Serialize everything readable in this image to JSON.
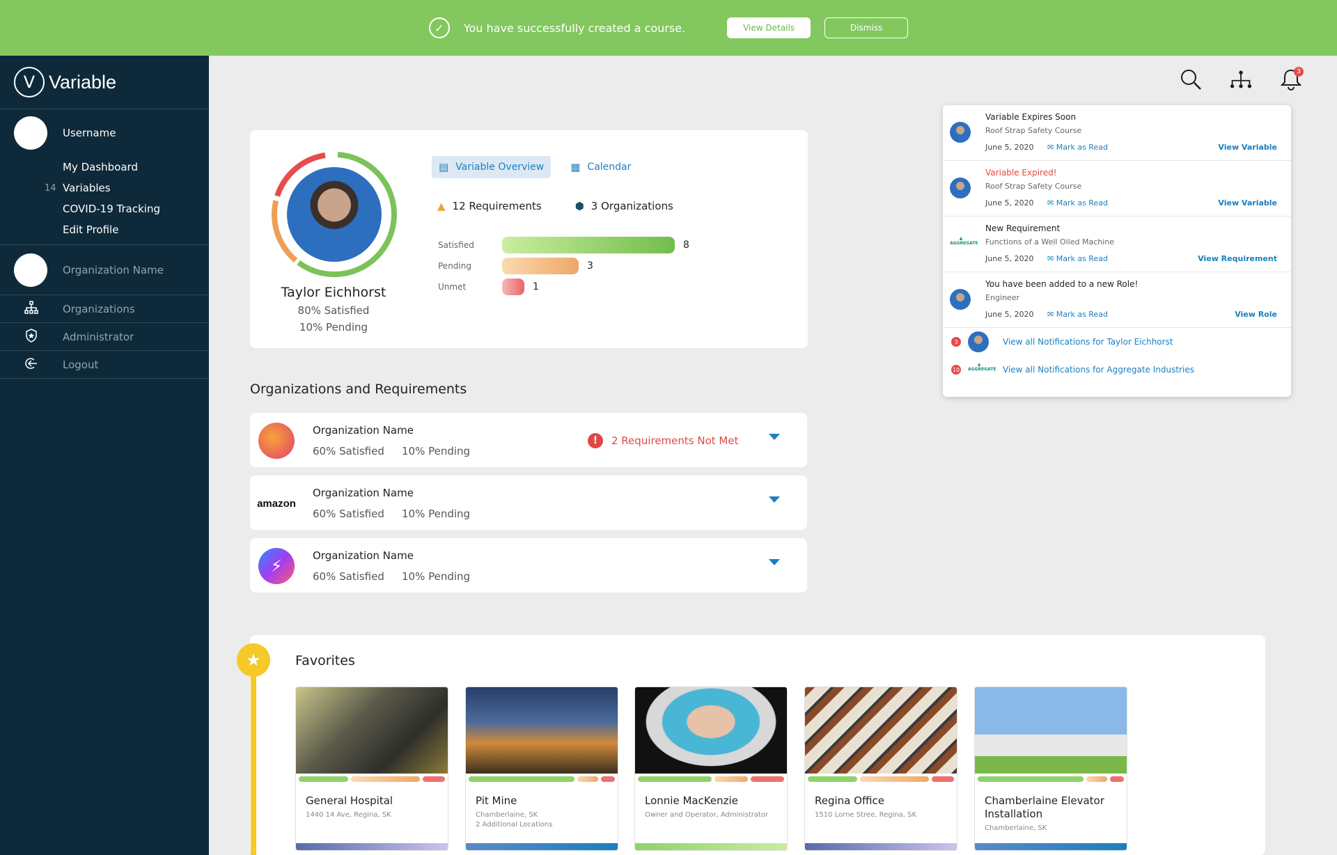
{
  "banner": {
    "message": "You have successfully created a course.",
    "view_details": "View Details",
    "dismiss": "Dismiss"
  },
  "sidebar": {
    "brand": "Variable",
    "username": "Username",
    "nav": [
      {
        "label": "My Dashboard",
        "badge": ""
      },
      {
        "label": "Variables",
        "badge": "14"
      },
      {
        "label": "COVID-19 Tracking",
        "badge": ""
      },
      {
        "label": "Edit Profile",
        "badge": ""
      }
    ],
    "org_name": "Organization Name",
    "links": [
      {
        "label": "Organizations",
        "icon": "hierarchy-icon"
      },
      {
        "label": "Administrator",
        "icon": "shield-icon"
      },
      {
        "label": "Logout",
        "icon": "logout-icon"
      }
    ]
  },
  "header": {
    "notification_count": "3"
  },
  "profile": {
    "name": "Taylor Eichhorst",
    "satisfied": "80% Satisfied",
    "pending": "10% Pending",
    "tab_overview": "Variable Overview",
    "tab_calendar": "Calendar",
    "requirements": "12 Requirements",
    "organizations": "3 Organizations",
    "bars": [
      {
        "label": "Satisfied",
        "value": 8,
        "color_from": "#c8ee9f",
        "color_to": "#72bd4a"
      },
      {
        "label": "Pending",
        "value": 3,
        "color_from": "#fbd9b1",
        "color_to": "#eea866"
      },
      {
        "label": "Unmet",
        "value": 1,
        "color_from": "#f7b8b8",
        "color_to": "#e96464"
      }
    ]
  },
  "orgs": {
    "title": "Organizations and Requirements",
    "items": [
      {
        "name": "Organization Name",
        "satisfied": "60% Satisfied",
        "pending": "10% Pending",
        "alert": "2 Requirements Not Met",
        "logo": "lion-logo"
      },
      {
        "name": "Organization Name",
        "satisfied": "60% Satisfied",
        "pending": "10% Pending",
        "alert": "",
        "logo": "amazon"
      },
      {
        "name": "Organization Name",
        "satisfied": "60% Satisfied",
        "pending": "10% Pending",
        "alert": "",
        "logo": "messenger-logo"
      }
    ]
  },
  "notifications": {
    "items": [
      {
        "title": "Variable Expires Soon",
        "sub": "Roof Strap Safety Course",
        "date": "June 5, 2020",
        "mark": "Mark as Read",
        "link": "View Variable"
      },
      {
        "title": "Variable Expired!",
        "sub": "Roof Strap Safety Course",
        "date": "June 5, 2020",
        "mark": "Mark as Read",
        "link": "View Variable"
      },
      {
        "title": "New Requirement",
        "sub": "Functions of a Well Oiled Machine",
        "date": "June 5, 2020",
        "mark": "Mark as Read",
        "link": "View Requirement"
      },
      {
        "title": "You have been added to a new Role!",
        "sub": "Engineer",
        "date": "June 5, 2020",
        "mark": "Mark as Read",
        "link": "View Role"
      }
    ],
    "footer": [
      {
        "count": "3",
        "label": "View all Notifications for Taylor Eichhorst"
      },
      {
        "count": "10",
        "label": "View all Notifications for Aggregate Industries"
      }
    ],
    "agg_logo_text": "AGGREGATE"
  },
  "favorites": {
    "title": "Favorites",
    "items": [
      {
        "name": "General Hospital",
        "sub": "1440 14 Ave, Regina, SK",
        "sub2": ""
      },
      {
        "name": "Pit Mine",
        "sub": "Chamberlaine, SK",
        "sub2": "2 Additional Locations"
      },
      {
        "name": "Lonnie MacKenzie",
        "sub": "Owner and Operator, Administrator",
        "sub2": ""
      },
      {
        "name": "Regina Office",
        "sub": "1510 Lorne Stree, Regina, SK",
        "sub2": ""
      },
      {
        "name": "Chamberlaine Elevator Installation",
        "sub": "Chamberlaine, SK",
        "sub2": ""
      }
    ]
  }
}
